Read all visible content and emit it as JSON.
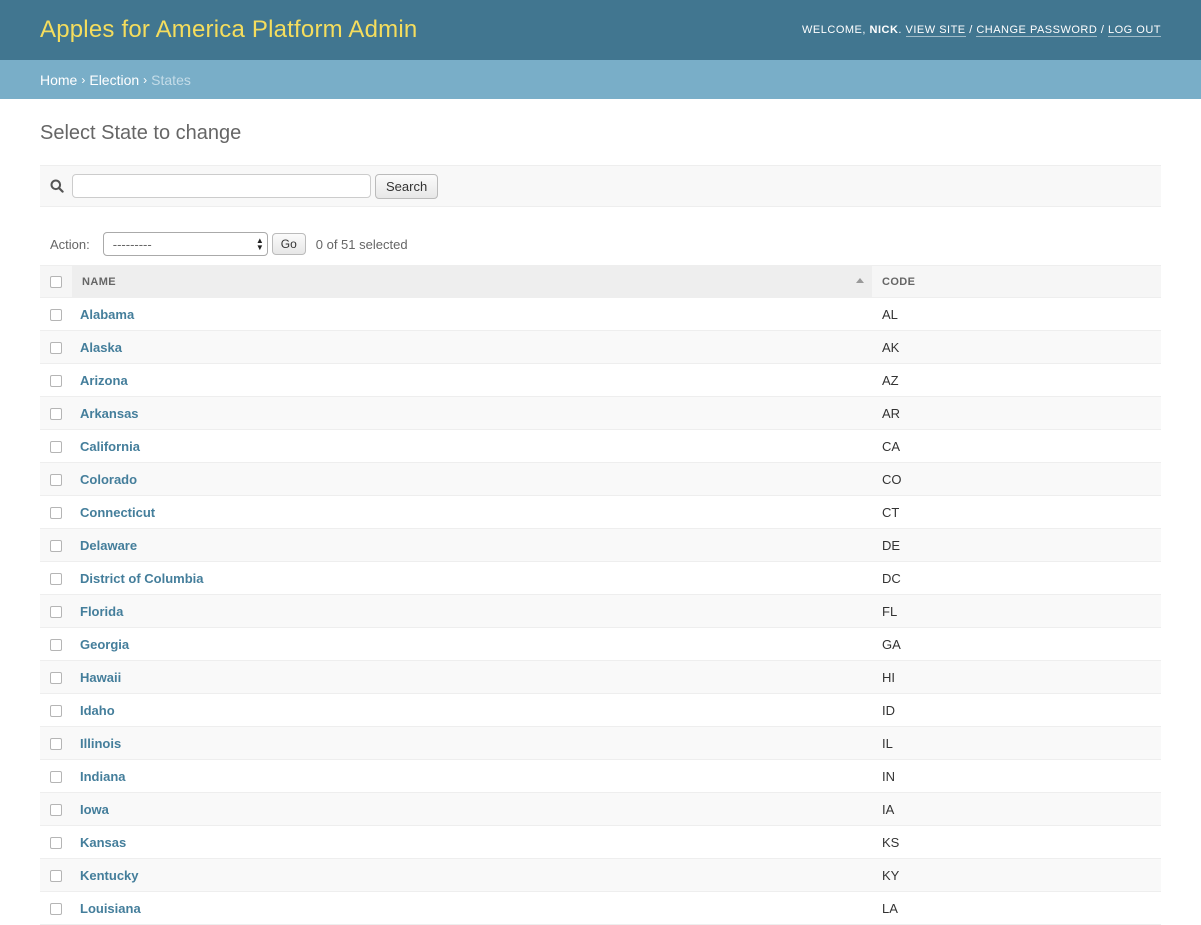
{
  "header": {
    "site_name": "Apples for America Platform Admin",
    "welcome": "Welcome,",
    "username": "Nick",
    "view_site": "View site",
    "change_password": "Change password",
    "log_out": "Log out"
  },
  "breadcrumbs": {
    "home": "Home",
    "election": "Election",
    "current": "States",
    "separator": "›"
  },
  "page_title": "Select State to change",
  "search": {
    "value": "",
    "button_label": "Search"
  },
  "actions": {
    "label": "Action:",
    "selected_option": "---------",
    "go_label": "Go",
    "counter": "0 of 51 selected"
  },
  "table": {
    "columns": {
      "name": "Name",
      "code": "Code"
    },
    "rows": [
      {
        "name": "Alabama",
        "code": "AL"
      },
      {
        "name": "Alaska",
        "code": "AK"
      },
      {
        "name": "Arizona",
        "code": "AZ"
      },
      {
        "name": "Arkansas",
        "code": "AR"
      },
      {
        "name": "California",
        "code": "CA"
      },
      {
        "name": "Colorado",
        "code": "CO"
      },
      {
        "name": "Connecticut",
        "code": "CT"
      },
      {
        "name": "Delaware",
        "code": "DE"
      },
      {
        "name": "District of Columbia",
        "code": "DC"
      },
      {
        "name": "Florida",
        "code": "FL"
      },
      {
        "name": "Georgia",
        "code": "GA"
      },
      {
        "name": "Hawaii",
        "code": "HI"
      },
      {
        "name": "Idaho",
        "code": "ID"
      },
      {
        "name": "Illinois",
        "code": "IL"
      },
      {
        "name": "Indiana",
        "code": "IN"
      },
      {
        "name": "Iowa",
        "code": "IA"
      },
      {
        "name": "Kansas",
        "code": "KS"
      },
      {
        "name": "Kentucky",
        "code": "KY"
      },
      {
        "name": "Louisiana",
        "code": "LA"
      }
    ]
  },
  "colors": {
    "header_bg": "#417690",
    "site_name": "#f5dd5d",
    "breadcrumbs_bg": "#79aec8",
    "link": "#447e9b"
  }
}
